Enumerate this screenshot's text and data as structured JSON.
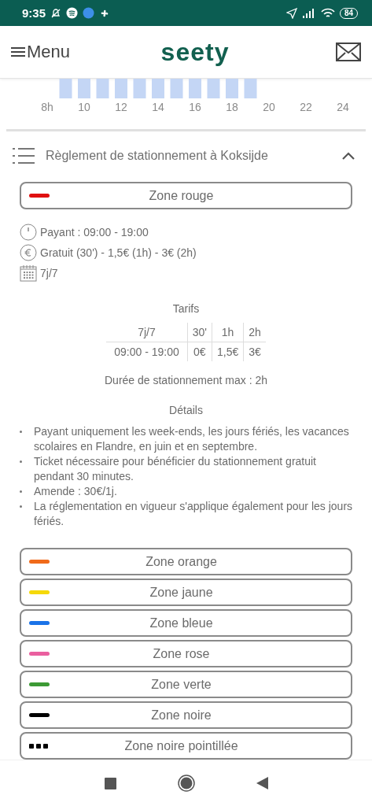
{
  "status_bar": {
    "time": "9:35",
    "battery": "84"
  },
  "header": {
    "menu_label": "Menu",
    "logo": "seety"
  },
  "occupancy": {
    "hour_labels": [
      "8h",
      "10",
      "12",
      "14",
      "16",
      "18",
      "20",
      "22",
      "24"
    ]
  },
  "section": {
    "title": "Règlement de stationnement à Koksijde",
    "expanded": true
  },
  "zones": [
    {
      "name": "Zone rouge",
      "color": "#e01010",
      "kind": "solid",
      "expanded": true,
      "info": [
        {
          "kind": "clock",
          "text": "Payant : 09:00 - 19:00"
        },
        {
          "kind": "euro",
          "text": "Gratuit (30') - 1,5€ (1h) - 3€ (2h)"
        },
        {
          "kind": "calendar",
          "text": "7j/7"
        }
      ],
      "tariffs": {
        "title": "Tarifs",
        "columns": [
          "7j/7",
          "30'",
          "1h",
          "2h"
        ],
        "rows": [
          [
            "09:00 - 19:00",
            "0€",
            "1,5€",
            "3€"
          ]
        ]
      },
      "max_duration": "Durée de stationnement max : 2h",
      "details_title": "Détails",
      "notes": [
        "Payant uniquement les week-ends, les jours fériés, les vacances scolaires en Flandre, en juin et en septembre.",
        "Ticket nécessaire pour bénéficier du stationnement gratuit pendant 30 minutes.",
        "Amende : 30€/1j.",
        "La réglementation en vigueur s'applique également pour les jours fériés."
      ]
    },
    {
      "name": "Zone orange",
      "color": "#f06a1a",
      "kind": "solid",
      "expanded": false
    },
    {
      "name": "Zone jaune",
      "color": "#f5d90a",
      "kind": "solid",
      "expanded": false
    },
    {
      "name": "Zone bleue",
      "color": "#1a73e8",
      "kind": "solid",
      "expanded": false
    },
    {
      "name": "Zone rose",
      "color": "#ea5f9f",
      "kind": "solid",
      "expanded": false
    },
    {
      "name": "Zone verte",
      "color": "#3c9a35",
      "kind": "solid",
      "expanded": false
    },
    {
      "name": "Zone noire",
      "color": "#000000",
      "kind": "solid",
      "expanded": false
    },
    {
      "name": "Zone noire pointillée",
      "color": "#000000",
      "kind": "dotted",
      "expanded": false
    }
  ]
}
